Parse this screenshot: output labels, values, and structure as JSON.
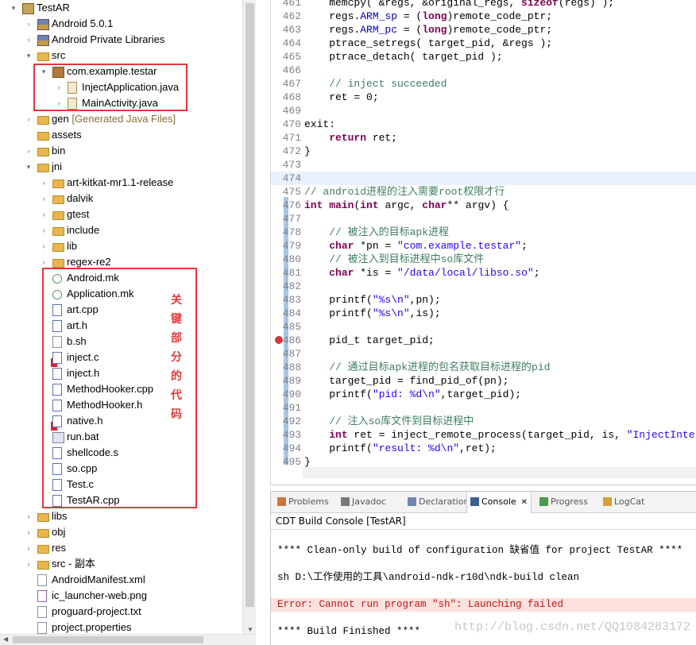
{
  "explorer": {
    "rows": [
      {
        "label": "TestAR",
        "indent": 0,
        "arrow": "▾",
        "icon": "project-icon"
      },
      {
        "label": "Android 5.0.1",
        "indent": 1,
        "arrow": "›",
        "icon": "library-icon"
      },
      {
        "label": "Android Private Libraries",
        "indent": 1,
        "arrow": "›",
        "icon": "library-icon"
      },
      {
        "label": "src",
        "indent": 1,
        "arrow": "▾",
        "icon": "source-folder-icon"
      },
      {
        "label": "com.example.testar",
        "indent": 2,
        "arrow": "▾",
        "icon": "package-icon"
      },
      {
        "label": "InjectApplication.java",
        "indent": 3,
        "arrow": "›",
        "icon": "java-file-icon"
      },
      {
        "label": "MainActivity.java",
        "indent": 3,
        "arrow": "›",
        "icon": "java-file-icon"
      },
      {
        "label": "gen",
        "decoration": "[Generated Java Files]",
        "indent": 1,
        "arrow": "›",
        "icon": "source-folder-icon"
      },
      {
        "label": "assets",
        "indent": 1,
        "arrow": "",
        "icon": "folder-icon"
      },
      {
        "label": "bin",
        "indent": 1,
        "arrow": "›",
        "icon": "folder-icon"
      },
      {
        "label": "jni",
        "indent": 1,
        "arrow": "▾",
        "icon": "folder-error-icon"
      },
      {
        "label": "art-kitkat-mr1.1-release",
        "indent": 2,
        "arrow": "›",
        "icon": "folder-icon"
      },
      {
        "label": "dalvik",
        "indent": 2,
        "arrow": "›",
        "icon": "folder-icon"
      },
      {
        "label": "gtest",
        "indent": 2,
        "arrow": "›",
        "icon": "folder-icon"
      },
      {
        "label": "include",
        "indent": 2,
        "arrow": "›",
        "icon": "folder-icon"
      },
      {
        "label": "lib",
        "indent": 2,
        "arrow": "›",
        "icon": "folder-icon"
      },
      {
        "label": "regex-re2",
        "indent": 2,
        "arrow": "›",
        "icon": "folder-icon"
      },
      {
        "label": "Android.mk",
        "indent": 2,
        "arrow": "",
        "icon": "makefile-icon"
      },
      {
        "label": "Application.mk",
        "indent": 2,
        "arrow": "",
        "icon": "makefile-icon"
      },
      {
        "label": "art.cpp",
        "indent": 2,
        "arrow": "",
        "icon": "c-file-icon"
      },
      {
        "label": "art.h",
        "indent": 2,
        "arrow": "",
        "icon": "c-file-icon"
      },
      {
        "label": "b.sh",
        "indent": 2,
        "arrow": "",
        "icon": "text-file-icon"
      },
      {
        "label": "inject.c",
        "indent": 2,
        "arrow": "",
        "icon": "c-file-error-icon"
      },
      {
        "label": "inject.h",
        "indent": 2,
        "arrow": "",
        "icon": "c-file-icon"
      },
      {
        "label": "MethodHooker.cpp",
        "indent": 2,
        "arrow": "",
        "icon": "c-file-icon"
      },
      {
        "label": "MethodHooker.h",
        "indent": 2,
        "arrow": "",
        "icon": "c-file-icon"
      },
      {
        "label": "native.h",
        "indent": 2,
        "arrow": "",
        "icon": "c-file-error-icon"
      },
      {
        "label": "run.bat",
        "indent": 2,
        "arrow": "",
        "icon": "batch-file-icon"
      },
      {
        "label": "shellcode.s",
        "indent": 2,
        "arrow": "",
        "icon": "asm-file-icon"
      },
      {
        "label": "so.cpp",
        "indent": 2,
        "arrow": "",
        "icon": "c-file-icon"
      },
      {
        "label": "Test.c",
        "indent": 2,
        "arrow": "",
        "icon": "c-file-icon"
      },
      {
        "label": "TestAR.cpp",
        "indent": 2,
        "arrow": "",
        "icon": "c-file-icon"
      },
      {
        "label": "libs",
        "indent": 1,
        "arrow": "›",
        "icon": "folder-icon"
      },
      {
        "label": "obj",
        "indent": 1,
        "arrow": "›",
        "icon": "folder-icon"
      },
      {
        "label": "res",
        "indent": 1,
        "arrow": "›",
        "icon": "folder-icon"
      },
      {
        "label": "src - 副本",
        "indent": 1,
        "arrow": "›",
        "icon": "folder-icon"
      },
      {
        "label": "AndroidManifest.xml",
        "indent": 1,
        "arrow": "",
        "icon": "xml-file-icon"
      },
      {
        "label": "ic_launcher-web.png",
        "indent": 1,
        "arrow": "",
        "icon": "image-file-icon"
      },
      {
        "label": "proguard-project.txt",
        "indent": 1,
        "arrow": "",
        "icon": "text-file-icon"
      },
      {
        "label": "project.properties",
        "indent": 1,
        "arrow": "",
        "icon": "text-file-icon"
      }
    ],
    "annotation": [
      "关",
      "键",
      "部",
      "分",
      "的",
      "代",
      "码"
    ]
  },
  "editor": {
    "lines": [
      {
        "n": "461",
        "t": [
          [
            "    memcpy( &regs, &original_regs, ",
            ""
          ],
          [
            "sizeof",
            "kw"
          ],
          [
            "(regs) );",
            ""
          ]
        ]
      },
      {
        "n": "462",
        "t": [
          [
            "    regs.",
            ""
          ],
          [
            "ARM_sp",
            "field"
          ],
          [
            " = (",
            ""
          ],
          [
            "long",
            "kw"
          ],
          [
            ")remote_code_ptr;",
            ""
          ]
        ]
      },
      {
        "n": "463",
        "t": [
          [
            "    regs.",
            ""
          ],
          [
            "ARM_pc",
            "field"
          ],
          [
            " = (",
            ""
          ],
          [
            "long",
            "kw"
          ],
          [
            ")remote_code_ptr;",
            ""
          ]
        ]
      },
      {
        "n": "464",
        "t": [
          [
            "    ptrace_setregs( target_pid, &regs );",
            ""
          ]
        ]
      },
      {
        "n": "465",
        "t": [
          [
            "    ptrace_detach( target_pid );",
            ""
          ]
        ]
      },
      {
        "n": "466",
        "t": []
      },
      {
        "n": "467",
        "t": [
          [
            "    // inject succeeded",
            "cmt"
          ]
        ]
      },
      {
        "n": "468",
        "t": [
          [
            "    ret = 0;",
            ""
          ]
        ]
      },
      {
        "n": "469",
        "t": []
      },
      {
        "n": "470",
        "t": [
          [
            "exit:",
            ""
          ]
        ]
      },
      {
        "n": "471",
        "t": [
          [
            "    ",
            ""
          ],
          [
            "return",
            "kw"
          ],
          [
            " ret;",
            ""
          ]
        ]
      },
      {
        "n": "472",
        "t": [
          [
            "}",
            ""
          ]
        ]
      },
      {
        "n": "473",
        "t": []
      },
      {
        "n": "474",
        "t": [],
        "current": true
      },
      {
        "n": "475",
        "t": [
          [
            "// android进程的注入需要root权限才行",
            "cmt"
          ]
        ]
      },
      {
        "n": "476",
        "t": [
          [
            "int",
            "kw"
          ],
          [
            " ",
            ""
          ],
          [
            "main",
            "kwb"
          ],
          [
            "(",
            ""
          ],
          [
            "int",
            "kw"
          ],
          [
            " argc, ",
            ""
          ],
          [
            "char",
            "kw"
          ],
          [
            "** argv) {",
            ""
          ]
        ]
      },
      {
        "n": "477",
        "t": []
      },
      {
        "n": "478",
        "t": [
          [
            "    // 被注入的目标apk进程",
            "cmt"
          ]
        ]
      },
      {
        "n": "479",
        "t": [
          [
            "    ",
            ""
          ],
          [
            "char",
            "kw"
          ],
          [
            " *pn = ",
            ""
          ],
          [
            "\"com.example.testar\"",
            "str"
          ],
          [
            ";",
            ""
          ]
        ]
      },
      {
        "n": "480",
        "t": [
          [
            "    // 被注入到目标进程中so库文件",
            "cmt"
          ]
        ]
      },
      {
        "n": "481",
        "t": [
          [
            "    ",
            ""
          ],
          [
            "char",
            "kw"
          ],
          [
            " *is = ",
            ""
          ],
          [
            "\"/data/local/libso.so\"",
            "str"
          ],
          [
            ";",
            ""
          ]
        ]
      },
      {
        "n": "482",
        "t": []
      },
      {
        "n": "483",
        "t": [
          [
            "    printf(",
            ""
          ],
          [
            "\"%s\\n\"",
            "str"
          ],
          [
            ",pn);",
            ""
          ]
        ]
      },
      {
        "n": "484",
        "t": [
          [
            "    printf(",
            ""
          ],
          [
            "\"%s\\n\"",
            "str"
          ],
          [
            ",is);",
            ""
          ]
        ]
      },
      {
        "n": "485",
        "t": []
      },
      {
        "n": "486",
        "t": [
          [
            "    pid_t target_pid;",
            ""
          ]
        ],
        "error": true
      },
      {
        "n": "487",
        "t": []
      },
      {
        "n": "488",
        "t": [
          [
            "    // 通过目标apk进程的包名获取目标进程的pid",
            "cmt"
          ]
        ]
      },
      {
        "n": "489",
        "t": [
          [
            "    target_pid = find_pid_of(pn);",
            ""
          ]
        ]
      },
      {
        "n": "490",
        "t": [
          [
            "    printf(",
            ""
          ],
          [
            "\"pid: %d\\n\"",
            "str"
          ],
          [
            ",target_pid);",
            ""
          ]
        ]
      },
      {
        "n": "491",
        "t": []
      },
      {
        "n": "492",
        "t": [
          [
            "    // 注入so库文件到目标进程中",
            "cmt"
          ]
        ]
      },
      {
        "n": "493",
        "t": [
          [
            "    ",
            ""
          ],
          [
            "int",
            "kw"
          ],
          [
            " ret = inject_remote_process(target_pid, is, ",
            ""
          ],
          [
            "\"InjectInterface\"",
            "str"
          ],
          [
            ",",
            ""
          ]
        ]
      },
      {
        "n": "494",
        "t": [
          [
            "    printf(",
            ""
          ],
          [
            "\"result: %d\\n\"",
            "str"
          ],
          [
            ",ret);",
            ""
          ]
        ]
      },
      {
        "n": "495",
        "t": [
          [
            "}",
            ""
          ]
        ]
      }
    ]
  },
  "views": {
    "tabs": [
      {
        "label": "Problems",
        "icon": "problems-icon"
      },
      {
        "label": "Javadoc",
        "icon": "javadoc-icon"
      },
      {
        "label": "Declaration",
        "icon": "declaration-icon"
      },
      {
        "label": "Console",
        "icon": "console-icon",
        "active": true
      },
      {
        "label": "Progress",
        "icon": "progress-icon"
      },
      {
        "label": "LogCat",
        "icon": "logcat-icon"
      }
    ],
    "console_title": "CDT Build Console [TestAR]",
    "console_lines": [
      {
        "text": "",
        "type": "normal"
      },
      {
        "text": "**** Clean-only build of configuration 缺省值 for project TestAR ****",
        "type": "normal"
      },
      {
        "text": "",
        "type": "normal"
      },
      {
        "text": "sh D:\\工作使用的工具\\android-ndk-r10d\\ndk-build clean",
        "type": "normal"
      },
      {
        "text": "",
        "type": "normal"
      },
      {
        "text": "Error: Cannot run program \"sh\": Launching failed",
        "type": "err"
      },
      {
        "text": "",
        "type": "normal"
      },
      {
        "text": "**** Build Finished ****",
        "type": "normal"
      }
    ],
    "watermark": "http://blog.csdn.net/QQ1084283172"
  },
  "colors": {
    "highlight_box": "#e0383c",
    "keyword": "#7f0055",
    "string": "#2a00ff",
    "comment": "#3f7f5f"
  }
}
